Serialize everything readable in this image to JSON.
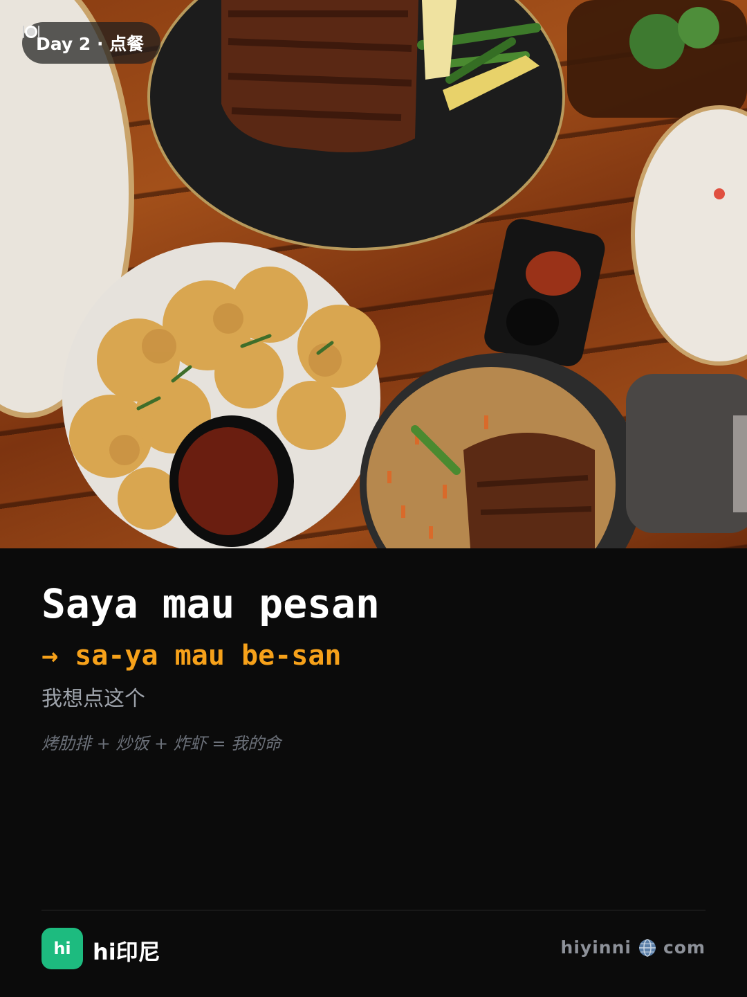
{
  "badge": {
    "icon": "plate-cutlery-icon",
    "label": "Day 2 · 点餐"
  },
  "phrase": {
    "indonesian": "Saya mau pesan",
    "pronunciation": "→ sa-ya mau be-san",
    "chinese": "我想点这个",
    "note": "烤肋排 + 炒饭 + 炸虾 = 我的命"
  },
  "footer": {
    "logo_text": "hi",
    "brand": "hi印尼",
    "site_left": "hiyinni",
    "site_icon": "globe-icon",
    "site_right": "com"
  },
  "colors": {
    "background": "#0b0b0b",
    "accent_orange": "#f6a11a",
    "logo_green": "#1dbb7f"
  }
}
